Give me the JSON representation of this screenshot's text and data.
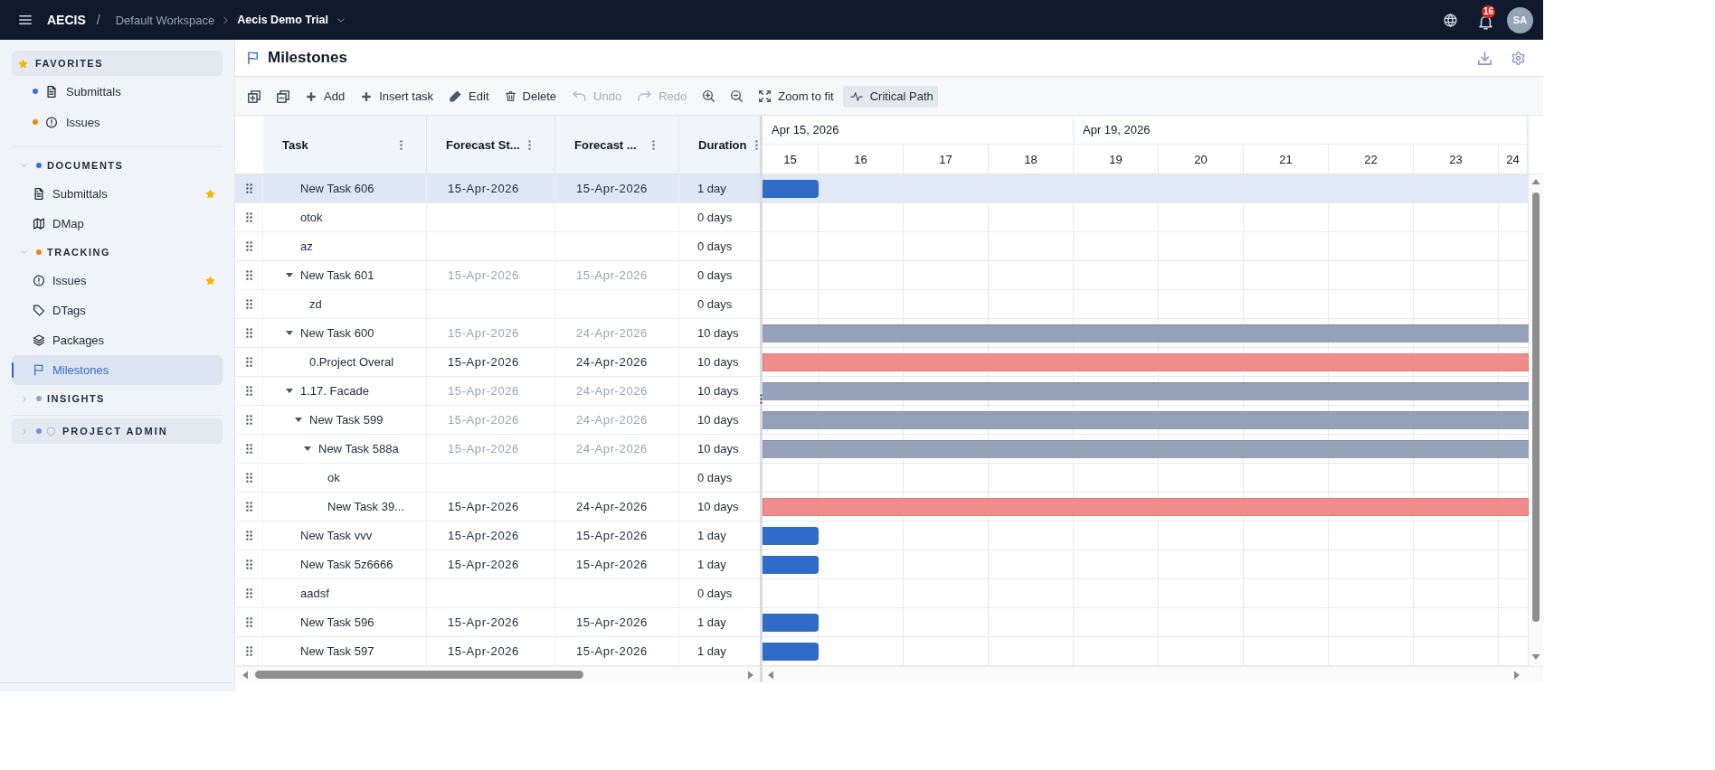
{
  "topbar": {
    "brand": "AECIS",
    "brand_separator": "/",
    "workspace": "Default Workspace",
    "project": "Aecis Demo Trial",
    "notifications": "16",
    "avatar": "SA"
  },
  "sidebar": {
    "favorites": {
      "title": "FAVORITES",
      "items": [
        {
          "label": "Submittals",
          "color": "#3a6fd8",
          "selected": false
        },
        {
          "label": "Issues",
          "color": "#e8851a",
          "selected": false
        }
      ]
    },
    "sections": [
      {
        "title": "DOCUMENTS",
        "color": "#3a6fd8",
        "expanded": true,
        "items": [
          {
            "label": "Submittals",
            "starred": true,
            "selected": false
          },
          {
            "label": "DMap",
            "starred": false,
            "selected": false
          }
        ]
      },
      {
        "title": "TRACKING",
        "color": "#e8851a",
        "expanded": true,
        "items": [
          {
            "label": "Issues",
            "starred": true,
            "selected": false
          },
          {
            "label": "DTags",
            "starred": false,
            "selected": false
          },
          {
            "label": "Packages",
            "starred": false,
            "selected": false
          },
          {
            "label": "Milestones",
            "starred": false,
            "selected": true
          }
        ]
      },
      {
        "title": "INSIGHTS",
        "color": "#9ca3af",
        "expanded": false
      }
    ],
    "admin": {
      "title": "PROJECT ADMIN",
      "color": "#6f94da",
      "expanded": false
    }
  },
  "page": {
    "title": "Milestones"
  },
  "toolbar": {
    "buttons": [
      {
        "label": "Add",
        "disabled": false
      },
      {
        "label": "Insert task",
        "disabled": false
      },
      {
        "label": "Edit",
        "disabled": false
      },
      {
        "label": "Delete",
        "disabled": false
      },
      {
        "label": "Undo",
        "disabled": true
      },
      {
        "label": "Redo",
        "disabled": true
      },
      {
        "label": "Zoom to fit",
        "disabled": false
      }
    ],
    "critical_path": {
      "label": "Critical Path",
      "on": true
    }
  },
  "table": {
    "columns": [
      "Task",
      "Forecast St...",
      "Forecast ...",
      "Duration"
    ],
    "rows": [
      {
        "task": "New Task 606",
        "forecast_start": "15-Apr-2026",
        "forecast_finish": "15-Apr-2026",
        "duration": "1 day",
        "selected": true,
        "bar": {
          "kind": "task",
          "level": 0.073
        }
      },
      {
        "task": "otok",
        "duration": "0 days",
        "selected": false
      },
      {
        "task": "az",
        "duration": "0 days",
        "selected": false
      },
      {
        "task": "New Task 601",
        "forecast_start": "15-Apr-2026",
        "forecast_finish": "15-Apr-2026",
        "duration": "0 days",
        "selected": false,
        "expanded": true,
        "children": [
          {
            "task": "zd",
            "duration": "0 days",
            "selected": false
          }
        ]
      },
      {
        "task": "New Task 600",
        "forecast_start": "15-Apr-2026",
        "forecast_finish": "24-Apr-2026",
        "duration": "10 days",
        "selected": false,
        "expanded": true,
        "bar": {
          "kind": "summary",
          "level": 1
        },
        "children": [
          {
            "task": "0.Project Overal",
            "forecast_start": "15-Apr-2026",
            "forecast_finish": "24-Apr-2026",
            "duration": "10 days",
            "selected": false,
            "bar": {
              "kind": "critical",
              "level": 1
            }
          }
        ]
      },
      {
        "task": "1.17. Facade",
        "forecast_start": "15-Apr-2026",
        "forecast_finish": "24-Apr-2026",
        "duration": "10 days",
        "selected": false,
        "expanded": true,
        "bar": {
          "kind": "summary",
          "level": 1
        },
        "children": [
          {
            "task": "New Task 599",
            "forecast_start": "15-Apr-2026",
            "forecast_finish": "24-Apr-2026",
            "duration": "10 days",
            "selected": false,
            "expanded": true,
            "bar": {
              "kind": "summary",
              "level": 1
            },
            "children": [
              {
                "task": "New Task 588a",
                "forecast_start": "15-Apr-2026",
                "forecast_finish": "24-Apr-2026",
                "duration": "10 days",
                "selected": false,
                "expanded": true,
                "bar": {
                  "kind": "summary",
                  "level": 1
                },
                "children": [
                  {
                    "task": "ok",
                    "duration": "0 days",
                    "selected": false
                  },
                  {
                    "task": "New Task 39...",
                    "forecast_start": "15-Apr-2026",
                    "forecast_finish": "24-Apr-2026",
                    "duration": "10 days",
                    "selected": false,
                    "bar": {
                      "kind": "critical",
                      "level": 1
                    }
                  }
                ]
              }
            ]
          }
        ]
      },
      {
        "task": "New Task vvv",
        "forecast_start": "15-Apr-2026",
        "forecast_finish": "15-Apr-2026",
        "duration": "1 day",
        "selected": false,
        "bar": {
          "kind": "task",
          "level": 0.073
        }
      },
      {
        "task": "New Task 5z6666",
        "forecast_start": "15-Apr-2026",
        "forecast_finish": "15-Apr-2026",
        "duration": "1 day",
        "selected": false,
        "bar": {
          "kind": "task",
          "level": 0.073
        }
      },
      {
        "task": "aadsf",
        "duration": "0 days",
        "selected": false
      },
      {
        "task": "New Task 596",
        "forecast_start": "15-Apr-2026",
        "forecast_finish": "15-Apr-2026",
        "duration": "1 day",
        "selected": false,
        "bar": {
          "kind": "task",
          "level": 0.073
        }
      },
      {
        "task": "New Task 597",
        "forecast_start": "15-Apr-2026",
        "forecast_finish": "15-Apr-2026",
        "duration": "1 day",
        "selected": false,
        "bar": {
          "kind": "task",
          "level": 0.073
        }
      }
    ]
  },
  "timeline": {
    "groups": [
      {
        "label": "Apr 15, 2026",
        "days": [
          "15",
          "16",
          "17",
          "18"
        ]
      },
      {
        "label": "Apr 19, 2026",
        "days": [
          "19",
          "20",
          "21",
          "22",
          "23",
          "24"
        ]
      }
    ]
  }
}
